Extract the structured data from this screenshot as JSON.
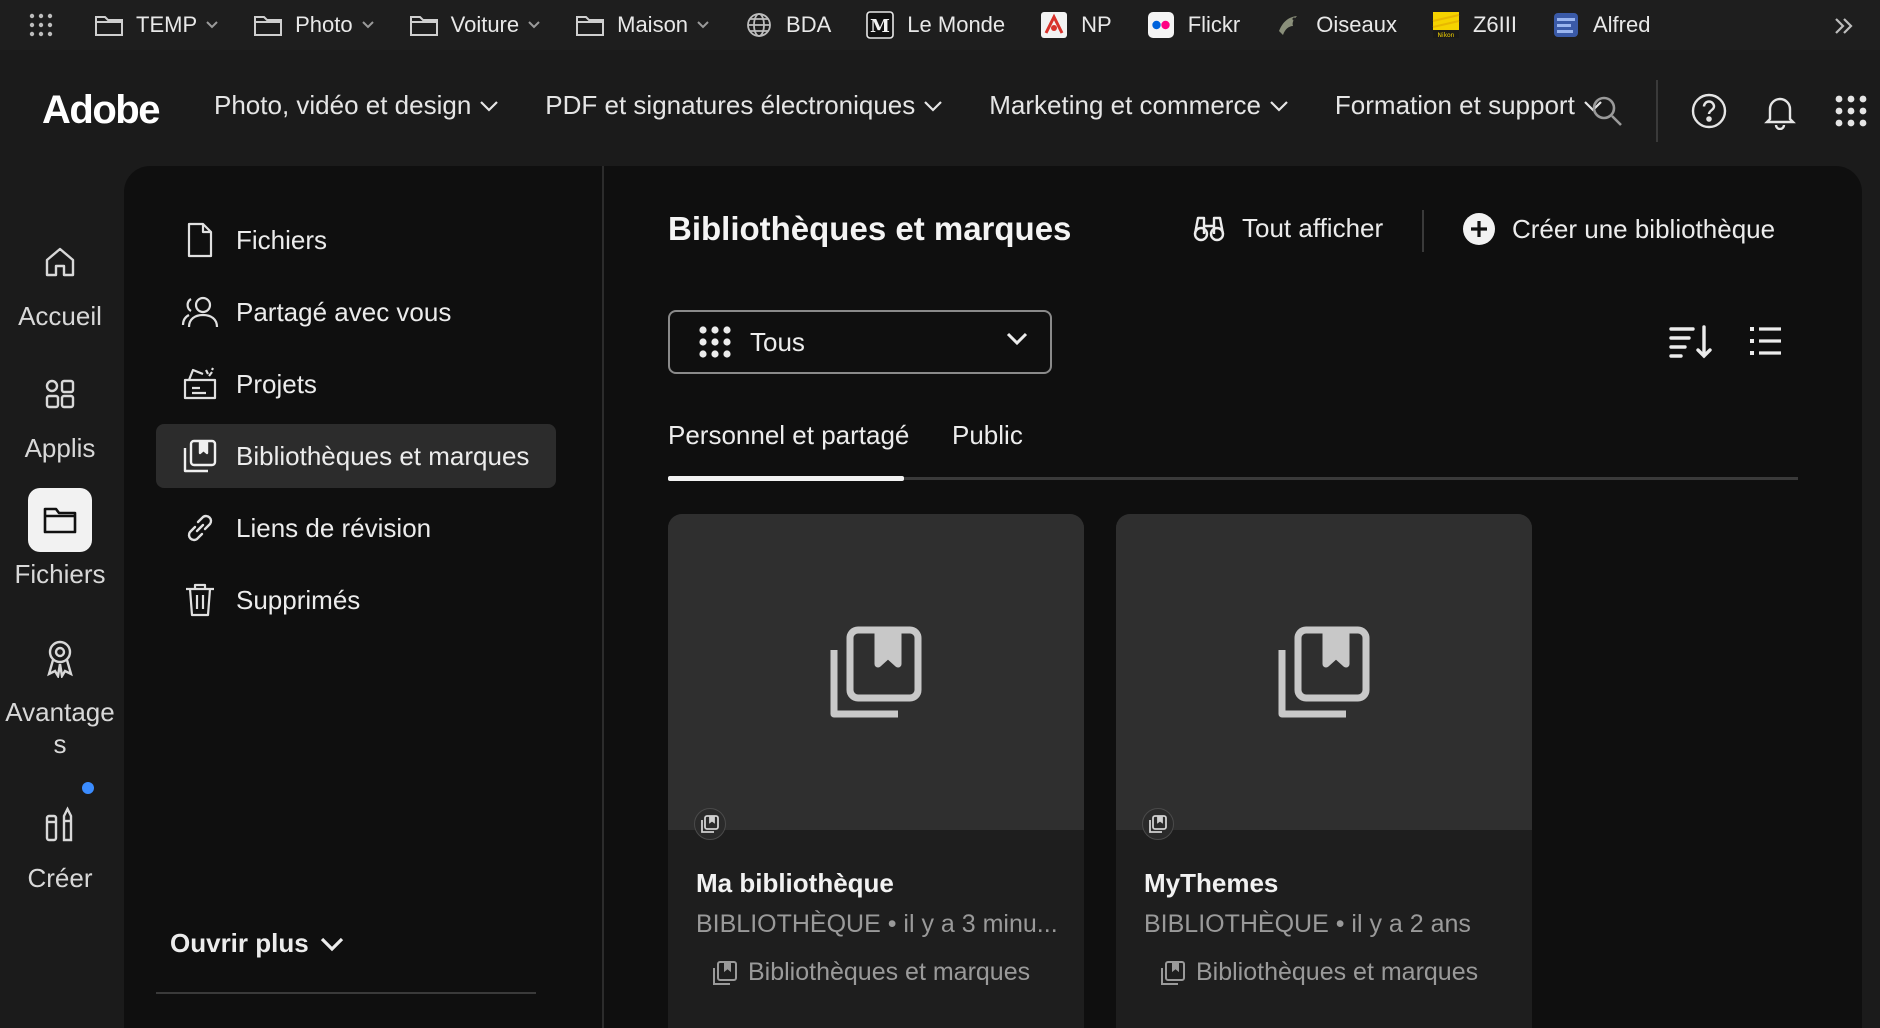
{
  "bookmarks": [
    {
      "label": "TEMP",
      "icon": "folder-icon",
      "dropdown": true
    },
    {
      "label": "Photo",
      "icon": "folder-icon",
      "dropdown": true
    },
    {
      "label": "Voiture",
      "icon": "folder-icon",
      "dropdown": true
    },
    {
      "label": "Maison",
      "icon": "folder-icon",
      "dropdown": true
    },
    {
      "label": "BDA",
      "icon": "globe-icon",
      "dropdown": false
    },
    {
      "label": "Le Monde",
      "icon": "le-monde-icon",
      "dropdown": false
    },
    {
      "label": "NP",
      "icon": "np-icon",
      "dropdown": false
    },
    {
      "label": "Flickr",
      "icon": "flickr-icon",
      "dropdown": false
    },
    {
      "label": "Oiseaux",
      "icon": "bird-icon",
      "dropdown": false
    },
    {
      "label": "Z6III",
      "icon": "nikon-icon",
      "dropdown": false
    },
    {
      "label": "Alfred",
      "icon": "alfred-icon",
      "dropdown": false
    }
  ],
  "header": {
    "logo": "Adobe",
    "nav": [
      "Photo, vidéo et design",
      "PDF et signatures électroniques",
      "Marketing et commerce",
      "Formation et support"
    ]
  },
  "rail": {
    "items": [
      "Accueil",
      "Applis",
      "Fichiers",
      "Avantage\ns",
      "Créer"
    ],
    "active": "Fichiers"
  },
  "sidenav": {
    "items": [
      {
        "label": "Fichiers",
        "icon": "file-icon"
      },
      {
        "label": "Partagé avec vous",
        "icon": "shared-users-icon"
      },
      {
        "label": "Projets",
        "icon": "projects-icon"
      },
      {
        "label": "Bibliothèques et marques",
        "icon": "library-icon"
      },
      {
        "label": "Liens de révision",
        "icon": "link-icon"
      },
      {
        "label": "Supprimés",
        "icon": "trash-icon"
      }
    ],
    "active": "Bibliothèques et marques",
    "open_more": "Ouvrir plus"
  },
  "content": {
    "title": "Bibliothèques et marques",
    "view_all": "Tout afficher",
    "create_library": "Créer une bibliothèque",
    "filter_value": "Tous",
    "tabs": [
      "Personnel et partagé",
      "Public"
    ],
    "active_tab": "Personnel et partagé",
    "cards": [
      {
        "title": "Ma bibliothèque",
        "meta": "BIBLIOTHÈQUE • il y a 3 minu...",
        "location": "Bibliothèques et marques"
      },
      {
        "title": "MyThemes",
        "meta": "BIBLIOTHÈQUE • il y a 2 ans",
        "location": "Bibliothèques et marques"
      }
    ]
  },
  "colors": {
    "accent_dot": "#3b8cff",
    "panel_bg": "#0f0f0f",
    "chrome_bg": "#1b1b1b"
  }
}
